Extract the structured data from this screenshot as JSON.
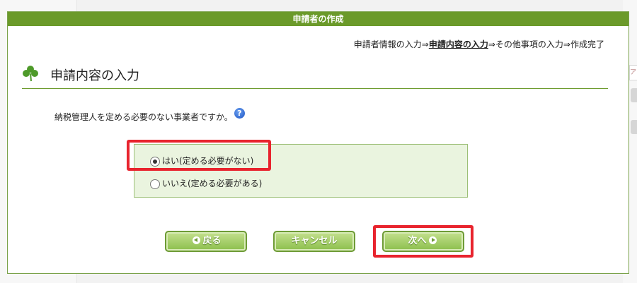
{
  "dialog": {
    "title": "申請者の作成"
  },
  "steps": {
    "step1": "申請者情報の入力",
    "sep1": "⇒",
    "step2": "申請内容の入力",
    "sep2": "⇒",
    "step3": "その他事項の入力",
    "sep3": "⇒",
    "step4": "作成完了"
  },
  "section": {
    "title": "申請内容の入力"
  },
  "question": {
    "text": "納税管理人を定める必要のない事業者ですか。",
    "help_icon": "?"
  },
  "options": [
    {
      "label": "はい(定める必要がない)",
      "selected": true
    },
    {
      "label": "いいえ(定める必要がある)",
      "selected": false
    }
  ],
  "buttons": {
    "back": "戻る",
    "cancel": "キャンセル",
    "next": "次へ"
  },
  "background": {
    "side_tab_text": "アロ"
  },
  "colors": {
    "title_bar": "#6b9a2a",
    "option_box": "#eaf4df",
    "highlight": "#e8242e",
    "button": "#8bbf4c"
  }
}
